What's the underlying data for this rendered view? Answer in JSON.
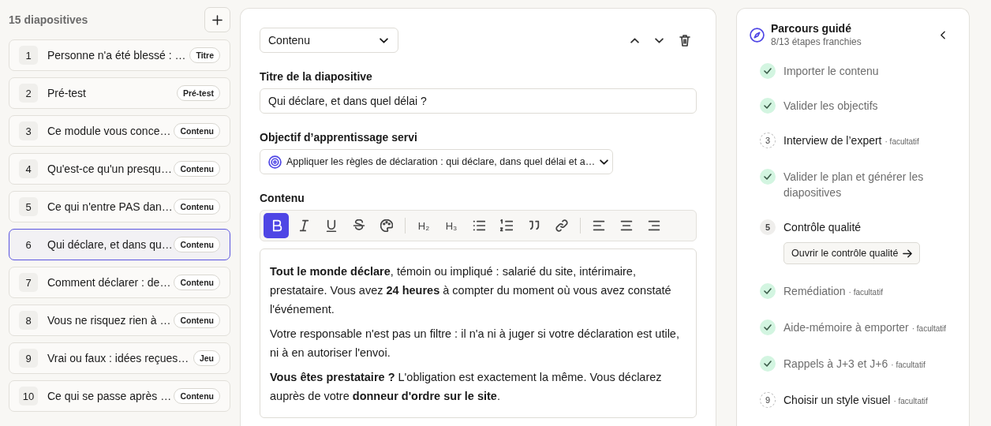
{
  "sidebar": {
    "title": "15 diapositives",
    "slides": [
      {
        "number": "1",
        "title": "Personne n'a été blessé : …",
        "badge": "Titre",
        "selected": false
      },
      {
        "number": "2",
        "title": "Pré-test",
        "badge": "Pré-test",
        "selected": false
      },
      {
        "number": "3",
        "title": "Ce module vous conce…",
        "badge": "Contenu",
        "selected": false
      },
      {
        "number": "4",
        "title": "Qu'est-ce qu'un presqu…",
        "badge": "Contenu",
        "selected": false
      },
      {
        "number": "5",
        "title": "Ce qui n'entre PAS dan…",
        "badge": "Contenu",
        "selected": false
      },
      {
        "number": "6",
        "title": "Qui déclare, et dans qu…",
        "badge": "Contenu",
        "selected": true
      },
      {
        "number": "7",
        "title": "Comment déclarer : de…",
        "badge": "Contenu",
        "selected": false
      },
      {
        "number": "8",
        "title": "Vous ne risquez rien à …",
        "badge": "Contenu",
        "selected": false
      },
      {
        "number": "9",
        "title": "Vrai ou faux : idées reçues…",
        "badge": "Jeu",
        "selected": false
      },
      {
        "number": "10",
        "title": "Ce qui se passe après …",
        "badge": "Contenu",
        "selected": false
      }
    ]
  },
  "editor": {
    "slide_type": "Contenu",
    "title_label": "Titre de la diapositive",
    "title_value": "Qui déclare, et dans quel délai ?",
    "objective_label": "Objectif d’apprentissage servi",
    "objective_value": "Appliquer les règles de déclaration : qui déclare, dans quel délai et a…",
    "content_label": "Contenu",
    "toolbar": [
      [
        {
          "kind": "bold",
          "selected": true
        },
        {
          "kind": "italic",
          "selected": false
        },
        {
          "kind": "underline",
          "selected": false
        },
        {
          "kind": "strike",
          "selected": false
        },
        {
          "kind": "color",
          "selected": false
        }
      ],
      [
        {
          "kind": "heading",
          "label": "H₂",
          "selected": false
        },
        {
          "kind": "heading",
          "label": "H₃",
          "selected": false
        },
        {
          "kind": "bullets",
          "selected": false
        },
        {
          "kind": "numbered",
          "selected": false
        },
        {
          "kind": "quote",
          "selected": false
        },
        {
          "kind": "link",
          "selected": false
        }
      ],
      [
        {
          "kind": "align-left",
          "selected": false
        },
        {
          "kind": "align-center",
          "selected": false
        },
        {
          "kind": "align-right",
          "selected": false
        }
      ]
    ],
    "paragraphs": [
      "**Tout le monde déclare**, témoin ou impliqué : salarié du site, intérimaire, prestataire. Vous avez **24 heures** à compter du moment où vous avez constaté l'événement.",
      "Votre responsable n'est pas un filtre : il n'a ni à juger si votre déclaration est utile, ni à en autoriser l'envoi.",
      "**Vous êtes prestataire ?** L'obligation est exactement la même. Vous déclarez auprès de votre **donneur d'ordre sur le site**."
    ]
  },
  "guide": {
    "title": "Parcours guidé",
    "subtitle": "8/13 étapes franchies",
    "steps": [
      {
        "kind": "done",
        "label": "Importer le contenu"
      },
      {
        "kind": "done",
        "label": "Valider les objectifs"
      },
      {
        "kind": "todo",
        "number": "3",
        "label": "Interview de l’expert",
        "note": "· facultatif"
      },
      {
        "kind": "done",
        "label": "Valider le plan et générer les diapositives"
      },
      {
        "kind": "current",
        "number": "5",
        "label": "Contrôle qualité",
        "action": "Ouvrir le contrôle qualité"
      },
      {
        "kind": "done",
        "label": "Remédiation",
        "note": "· facultatif"
      },
      {
        "kind": "done",
        "label": "Aide-mémoire à emporter",
        "note": "· facultatif"
      },
      {
        "kind": "done",
        "label": "Rappels à J+3 et J+6",
        "note": "· facultatif"
      },
      {
        "kind": "todo",
        "number": "9",
        "label": "Choisir un style visuel",
        "note": "· facultatif"
      }
    ]
  }
}
